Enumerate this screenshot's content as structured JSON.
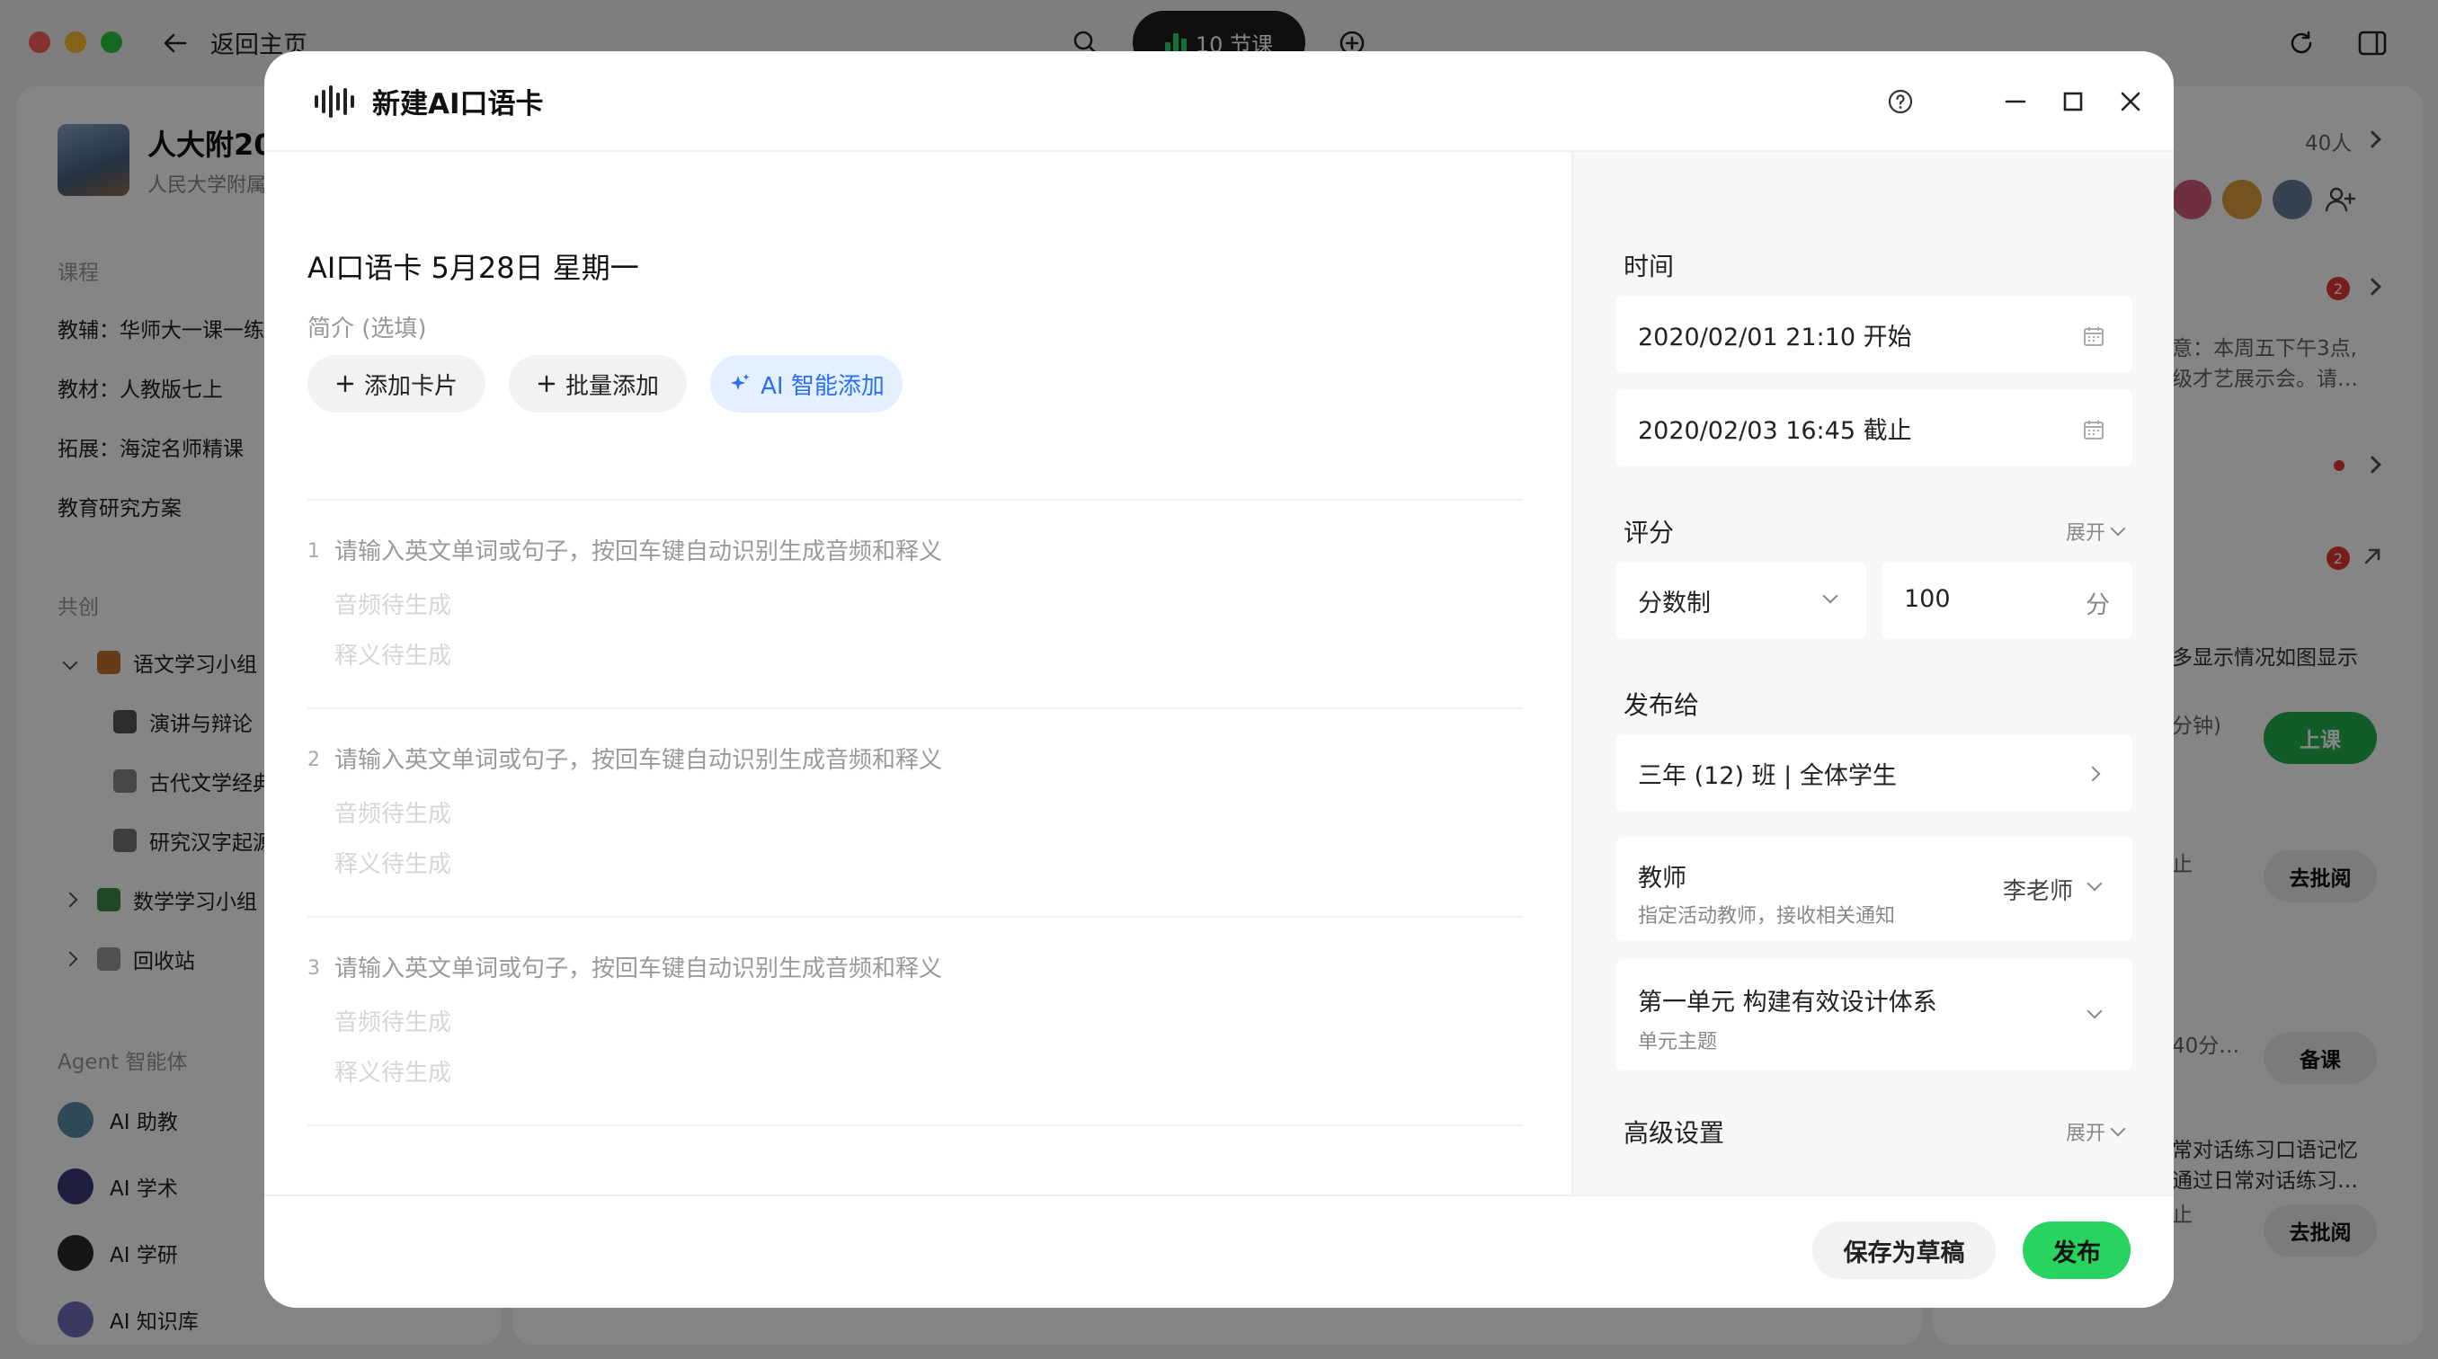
{
  "background": {
    "back_label": "返回主页",
    "lesson_pill": "10 节课",
    "school": {
      "name": "人大附20",
      "sub": "人民大学附属"
    },
    "sections": {
      "course": "课程",
      "cocreate": "共创",
      "agent": "Agent 智能体"
    },
    "course_items": [
      "教辅：华师大一课一练",
      "教材：人教版七上",
      "拓展：海淀名师精课",
      "教育研究方案"
    ],
    "tree": {
      "yuwen": "语文学习小组",
      "speech": "演讲与辩论",
      "ancient": "古代文学经典",
      "hanzi": "研究汉字起源",
      "math": "数学学习小组",
      "recycle": "回收站"
    },
    "agents": [
      "AI 助教",
      "AI 学术",
      "AI 学研",
      "AI 知识库"
    ],
    "right": {
      "member_count": "40人",
      "badge1": "2",
      "badge2": "2",
      "notice1": "意：本周五下午3点,",
      "notice2": "级才艺展示会。请…",
      "notice3": "多显示情况如图显示",
      "minutes": "分钟)",
      "ended1": "止",
      "btn_class": "上课",
      "btn_review1": "去批阅",
      "time_40": "40分…",
      "btn_prepare": "备课",
      "notice4": "常对话练习口语记忆",
      "notice5": "通过日常对话练习…",
      "ended2": "止",
      "btn_review2": "去批阅"
    }
  },
  "modal": {
    "title": "新建AI口语卡",
    "doc_title": "AI口语卡 5月28日 星期一",
    "description_placeholder": "简介 (选填)",
    "actions": {
      "add_card": "添加卡片",
      "batch_add": "批量添加",
      "ai_add": "AI 智能添加"
    },
    "cards": [
      {
        "index": "1",
        "prompt": "请输入英文单词或句子，按回车键自动识别生成音频和释义",
        "audio": "音频待生成",
        "meaning": "释义待生成"
      },
      {
        "index": "2",
        "prompt": "请输入英文单词或句子，按回车键自动识别生成音频和释义",
        "audio": "音频待生成",
        "meaning": "释义待生成"
      },
      {
        "index": "3",
        "prompt": "请输入英文单词或句子，按回车键自动识别生成音频和释义",
        "audio": "音频待生成",
        "meaning": "释义待生成"
      }
    ],
    "settings": {
      "time_label": "时间",
      "start": "2020/02/01 21:10 开始",
      "end": "2020/02/03 16:45 截止",
      "score_label": "评分",
      "expand": "展开",
      "score_mode": "分数制",
      "score_value": "100",
      "score_unit": "分",
      "publish_to_label": "发布给",
      "publish_to": "三年 (12) 班 | 全体学生",
      "teacher_label": "教师",
      "teacher_hint": "指定活动教师，接收相关通知",
      "teacher_value": "李老师",
      "unit_title": "第一单元 构建有效设计体系",
      "unit_hint": "单元主题",
      "advanced_label": "高级设置",
      "advanced_expand": "展开"
    },
    "footer": {
      "save_draft": "保存为草稿",
      "publish": "发布"
    },
    "colors": {
      "publish_green": "#28d35f",
      "ai_blue": "#2a6ff2"
    }
  }
}
